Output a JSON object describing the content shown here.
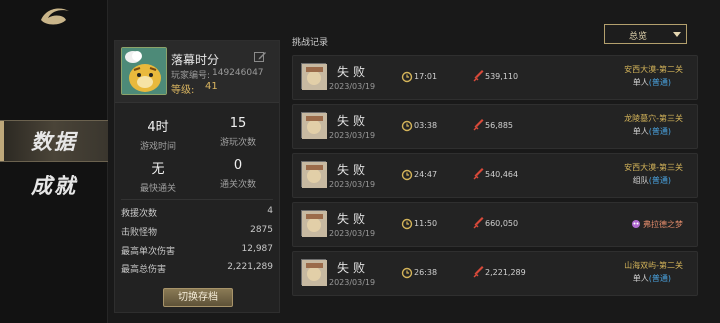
{
  "nav": {
    "items": [
      {
        "label": "数据",
        "active": true
      },
      {
        "label": "成就",
        "active": false
      }
    ]
  },
  "profile": {
    "name": "落幕时分",
    "player_id_label": "玩家编号:",
    "player_id": "149246047",
    "level_label": "等级:",
    "level": "41",
    "stats": [
      {
        "value": "4时",
        "label": "游戏时间"
      },
      {
        "value": "15",
        "label": "游玩次数"
      },
      {
        "value": "无",
        "label": "最快通关"
      },
      {
        "value": "0",
        "label": "通关次数"
      }
    ],
    "details": [
      {
        "key": "救援次数",
        "value": "4"
      },
      {
        "key": "击败怪物",
        "value": "2875"
      },
      {
        "key": "最高单次伤害",
        "value": "12,987"
      },
      {
        "key": "最高总伤害",
        "value": "2,221,289"
      }
    ],
    "switch_button": "切换存档"
  },
  "records": {
    "title": "挑战记录",
    "filter": "总览",
    "rows": [
      {
        "result": "失败",
        "date": "2023/03/19",
        "time": "17:01",
        "damage": "539,110",
        "stage": "安西大漠-第二关",
        "mode": "单人",
        "difficulty": "(普通)",
        "boss": ""
      },
      {
        "result": "失败",
        "date": "2023/03/19",
        "time": "03:38",
        "damage": "56,885",
        "stage": "龙陵墓穴-第三关",
        "mode": "单人",
        "difficulty": "(普通)",
        "boss": ""
      },
      {
        "result": "失败",
        "date": "2023/03/19",
        "time": "24:47",
        "damage": "540,464",
        "stage": "安西大漠-第三关",
        "mode": "组队",
        "difficulty": "(普通)",
        "boss": ""
      },
      {
        "result": "失败",
        "date": "2023/03/19",
        "time": "11:50",
        "damage": "660,050",
        "stage": "",
        "mode": "",
        "difficulty": "",
        "boss": "弗拉德之梦"
      },
      {
        "result": "失败",
        "date": "2023/03/19",
        "time": "26:38",
        "damage": "2,221,289",
        "stage": "山海双屿-第二关",
        "mode": "单人",
        "difficulty": "(普通)",
        "boss": ""
      }
    ]
  }
}
